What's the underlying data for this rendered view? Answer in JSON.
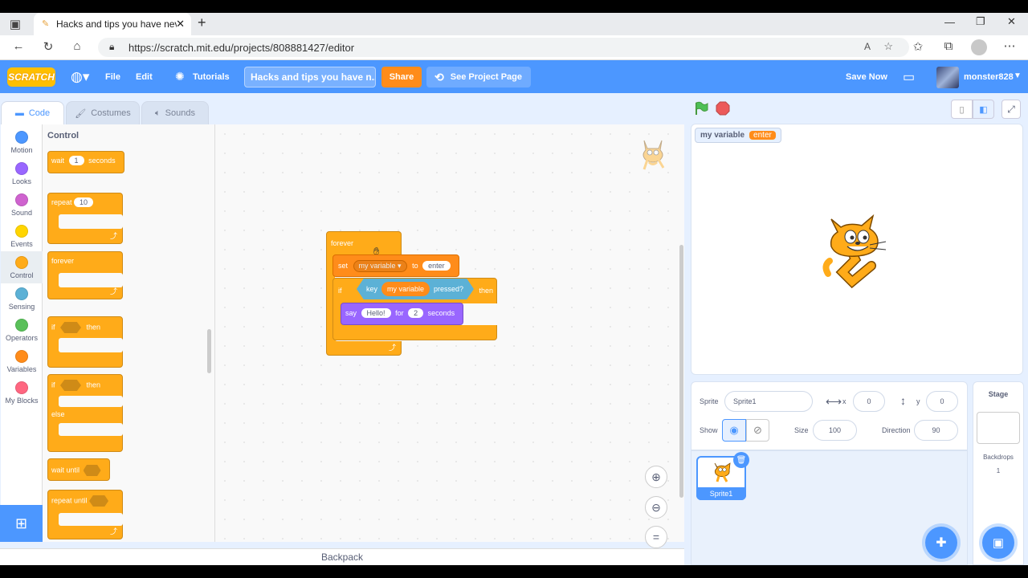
{
  "browser": {
    "tab_title": "Hacks and tips you have never k",
    "url": "https://scratch.mit.edu/projects/808881427/editor",
    "new_tab": "+"
  },
  "menu": {
    "logo": "SCRATCH",
    "file": "File",
    "edit": "Edit",
    "tutorials": "Tutorials",
    "project_title": "Hacks and tips you have n...",
    "share": "Share",
    "see_project_page": "See Project Page",
    "save_now": "Save Now",
    "username": "monster828"
  },
  "tabs": {
    "code": "Code",
    "costumes": "Costumes",
    "sounds": "Sounds"
  },
  "categories": [
    {
      "label": "Motion",
      "color": "#4c97ff"
    },
    {
      "label": "Looks",
      "color": "#9966ff"
    },
    {
      "label": "Sound",
      "color": "#cf63cf"
    },
    {
      "label": "Events",
      "color": "#ffd500"
    },
    {
      "label": "Control",
      "color": "#ffab19"
    },
    {
      "label": "Sensing",
      "color": "#5cb1d6"
    },
    {
      "label": "Operators",
      "color": "#59c059"
    },
    {
      "label": "Variables",
      "color": "#ff8c1a"
    },
    {
      "label": "My Blocks",
      "color": "#ff6680"
    }
  ],
  "palette": {
    "heading": "Control",
    "wait": "wait",
    "wait_val": "1",
    "seconds": "seconds",
    "repeat": "repeat",
    "repeat_val": "10",
    "forever": "forever",
    "if": "if",
    "then": "then",
    "if2": "if",
    "then2": "then",
    "else": "else",
    "wait_until": "wait until",
    "repeat_until": "repeat until"
  },
  "script": {
    "forever": "forever",
    "set": "set",
    "set_var": "my variable",
    "to": "to",
    "set_val": "enter",
    "if": "if",
    "key": "key",
    "key_var": "my variable",
    "pressed": "pressed?",
    "then": "then",
    "say": "say",
    "say_val": "Hello!",
    "for": "for",
    "say_secs": "2",
    "seconds": "seconds"
  },
  "stage": {
    "monitor_label": "my variable",
    "monitor_value": "enter"
  },
  "sprite_info": {
    "sprite_label": "Sprite",
    "sprite_name": "Sprite1",
    "x_label": "x",
    "x_val": "0",
    "y_label": "y",
    "y_val": "0",
    "show_label": "Show",
    "size_label": "Size",
    "size_val": "100",
    "direction_label": "Direction",
    "direction_val": "90"
  },
  "sprites": [
    {
      "name": "Sprite1"
    }
  ],
  "stage_panel": {
    "title": "Stage",
    "backdrops_label": "Backdrops",
    "backdrops_count": "1"
  },
  "backpack": "Backpack"
}
